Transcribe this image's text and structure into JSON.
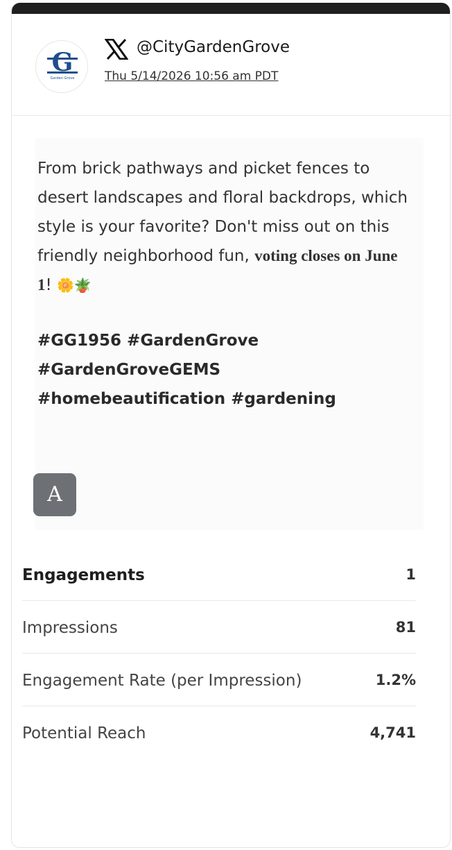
{
  "account": {
    "handle": "@CityGardenGrove",
    "timestamp": "Thu 5/14/2026 10:56 am PDT",
    "avatar_letter": "G",
    "avatar_caption": "Garden Grove",
    "platform_icon": "x-logo-icon"
  },
  "post": {
    "text_main": "From brick pathways and picket fences to desert landscapes and floral backdrops, which style is your favorite? Don't miss out on this friendly neighborhood fun, ",
    "text_emphasis": "voting closes on June 1",
    "text_end": "! ",
    "emoji": "🌼🪴",
    "hashtags": [
      "#GG1956 #GardenGrove",
      "#GardenGroveGEMS",
      "#homebeautification #gardening"
    ],
    "media_button_label": "A"
  },
  "metrics": [
    {
      "label": "Engagements",
      "value": "1"
    },
    {
      "label": "Impressions",
      "value": "81"
    },
    {
      "label": "Engagement Rate (per Impression)",
      "value": "1.2%"
    },
    {
      "label": "Potential Reach",
      "value": "4,741"
    }
  ],
  "colors": {
    "top_bar": "#1f1f1f",
    "avatar_blue": "#1f4e8c",
    "button_gray": "#6d7175"
  }
}
